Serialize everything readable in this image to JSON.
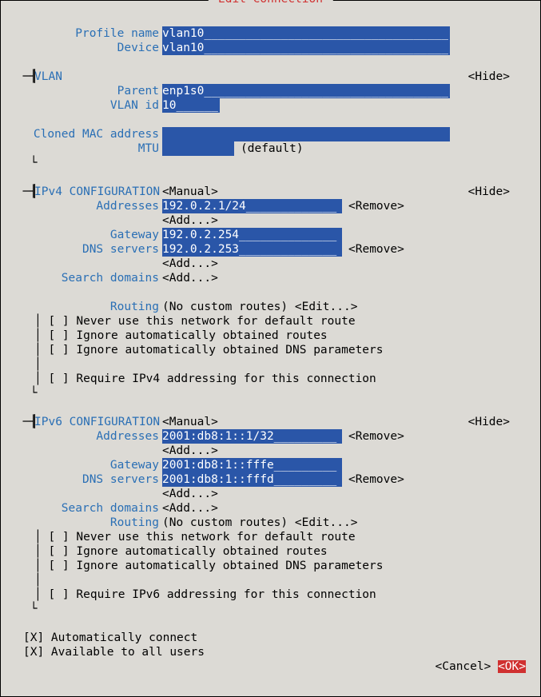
{
  "title": " Edit Connection ",
  "hide_label": "<Hide>",
  "profile": {
    "label": "Profile name",
    "value": "vlan10___________________________________"
  },
  "device": {
    "label": "Device",
    "value": "vlan10___________________________________"
  },
  "vlan": {
    "header": "VLAN",
    "parent_label": "Parent",
    "parent_value": "enp1s0___________________________________",
    "id_label": "VLAN id",
    "id_value": "10______",
    "mac_label": "Cloned MAC address",
    "mac_value": "                                        ",
    "mtu_label": "MTU",
    "mtu_value": "          ",
    "mtu_default": "(default)"
  },
  "ipv4": {
    "header": "IPv4 CONFIGURATION",
    "mode": "<Manual>",
    "addresses_label": "Addresses",
    "address_value": "192.0.2.1/24_____________",
    "remove": "<Remove>",
    "add": "<Add...>",
    "gateway_label": "Gateway",
    "gateway_value": "192.0.2.254______________",
    "dns_label": "DNS servers",
    "dns_value": "192.0.2.253______________",
    "search_label": "Search domains",
    "routing_label": "Routing",
    "routing_value": "(No custom routes) <Edit...>",
    "chk1": "[ ] Never use this network for default route",
    "chk2": "[ ] Ignore automatically obtained routes",
    "chk3": "[ ] Ignore automatically obtained DNS parameters",
    "chk4": "[ ] Require IPv4 addressing for this connection"
  },
  "ipv6": {
    "header": "IPv6 CONFIGURATION",
    "mode": "<Manual>",
    "addresses_label": "Addresses",
    "address_value": "2001:db8:1::1/32_________",
    "remove": "<Remove>",
    "add": "<Add...>",
    "gateway_label": "Gateway",
    "gateway_value": "2001:db8:1::fffe_________",
    "dns_label": "DNS servers",
    "dns_value": "2001:db8:1::fffd_________",
    "search_label": "Search domains",
    "routing_label": "Routing",
    "routing_value": "(No custom routes) <Edit...>",
    "chk1": "[ ] Never use this network for default route",
    "chk2": "[ ] Ignore automatically obtained routes",
    "chk3": "[ ] Ignore automatically obtained DNS parameters",
    "chk4": "[ ] Require IPv6 addressing for this connection"
  },
  "auto_connect": "[X] Automatically connect",
  "all_users": "[X] Available to all users",
  "cancel": "<Cancel>",
  "ok": "<OK>"
}
